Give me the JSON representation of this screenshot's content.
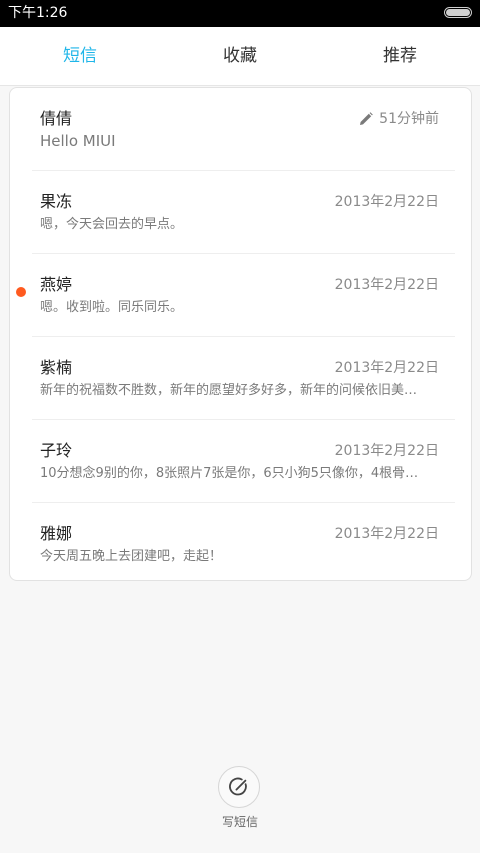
{
  "status_bar": {
    "time": "下午1:26"
  },
  "tabs": [
    {
      "label": "短信",
      "active": true
    },
    {
      "label": "收藏",
      "active": false
    },
    {
      "label": "推荐",
      "active": false
    }
  ],
  "conversations": [
    {
      "name": "倩倩",
      "preview": "Hello MIUI",
      "time": "51分钟前",
      "draft": true,
      "unread": false
    },
    {
      "name": "果冻",
      "preview": "嗯，今天会回去的早点。",
      "time": "2013年2月22日",
      "draft": false,
      "unread": false
    },
    {
      "name": "燕婷",
      "preview": "嗯。收到啦。同乐同乐。",
      "time": "2013年2月22日",
      "draft": false,
      "unread": true
    },
    {
      "name": "紫楠",
      "preview": "新年的祝福数不胜数，新年的愿望好多好多，新年的问候依旧美…",
      "time": "2013年2月22日",
      "draft": false,
      "unread": false
    },
    {
      "name": "子玲",
      "preview": "10分想念9别的你，8张照片7张是你，6只小狗5只像你，4根骨…",
      "time": "2013年2月22日",
      "draft": false,
      "unread": false
    },
    {
      "name": "雅娜",
      "preview": "今天周五晚上去团建吧，走起！",
      "time": "2013年2月22日",
      "draft": false,
      "unread": false
    }
  ],
  "compose": {
    "label": "写短信"
  },
  "colors": {
    "accent": "#1fb6e9",
    "unread_dot": "#ff5a1f"
  },
  "icons": {
    "draft": "pencil-icon",
    "compose": "compose-icon",
    "battery": "battery-icon"
  }
}
